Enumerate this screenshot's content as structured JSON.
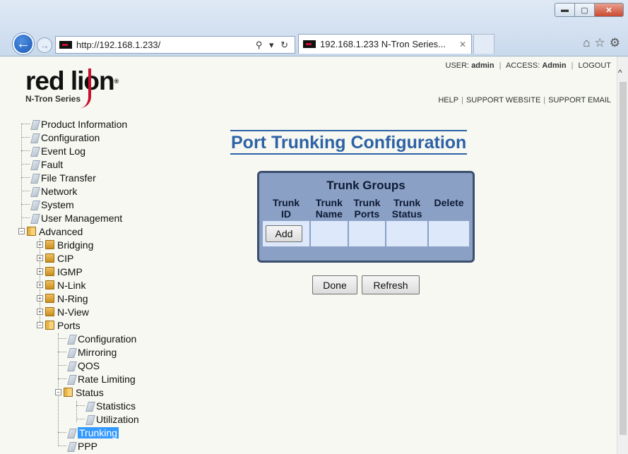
{
  "browser": {
    "url": "http://192.168.1.233/",
    "address_icons": "⚲ ▾ ↻",
    "tab_title": "192.168.1.233 N-Tron Series...",
    "tab_close": "✕",
    "back": "←",
    "forward": "→",
    "window_buttons": {
      "minimize": "▬",
      "maximize": "▢",
      "close": "✕"
    },
    "tool_icons": "⌂☆⚙"
  },
  "logo": {
    "text_red": "red ",
    "text_lion": "lion",
    "registered": "®",
    "subtitle": "N-Tron Series"
  },
  "userbar": {
    "user_label": "USER:",
    "user": "admin",
    "access_label": "ACCESS:",
    "access": "Admin",
    "logout": "LOGOUT"
  },
  "helpbar": {
    "help": "HELP",
    "support_website": "SUPPORT WEBSITE",
    "support_email": "SUPPORT EMAIL"
  },
  "tree": {
    "top": [
      "Product Information",
      "Configuration",
      "Event Log",
      "Fault",
      "File Transfer",
      "Network",
      "System",
      "User Management"
    ],
    "advanced": "Advanced",
    "advanced_children": [
      "Bridging",
      "CIP",
      "IGMP",
      "N-Link",
      "N-Ring",
      "N-View"
    ],
    "ports": "Ports",
    "ports_children": [
      "Configuration",
      "Mirroring",
      "QOS",
      "Rate Limiting"
    ],
    "status": "Status",
    "status_children": [
      "Statistics",
      "Utilization"
    ],
    "trunking": "Trunking",
    "ppp": "PPP"
  },
  "main": {
    "title": "Port Trunking Configuration",
    "table_caption": "Trunk Groups",
    "columns": [
      {
        "line1": "Trunk",
        "line2": "ID"
      },
      {
        "line1": "Trunk",
        "line2": "Name"
      },
      {
        "line1": "Trunk",
        "line2": "Ports"
      },
      {
        "line1": "Trunk",
        "line2": "Status"
      },
      {
        "line1": "Delete",
        "line2": ""
      }
    ],
    "add_label": "Add",
    "done_label": "Done",
    "refresh_label": "Refresh"
  },
  "colors": {
    "title_blue": "#2e62a6",
    "table_header": "#8aa0c4",
    "cell_bg": "#dde8fb",
    "logo_red": "#c8102e",
    "selected": "#3399ff"
  }
}
